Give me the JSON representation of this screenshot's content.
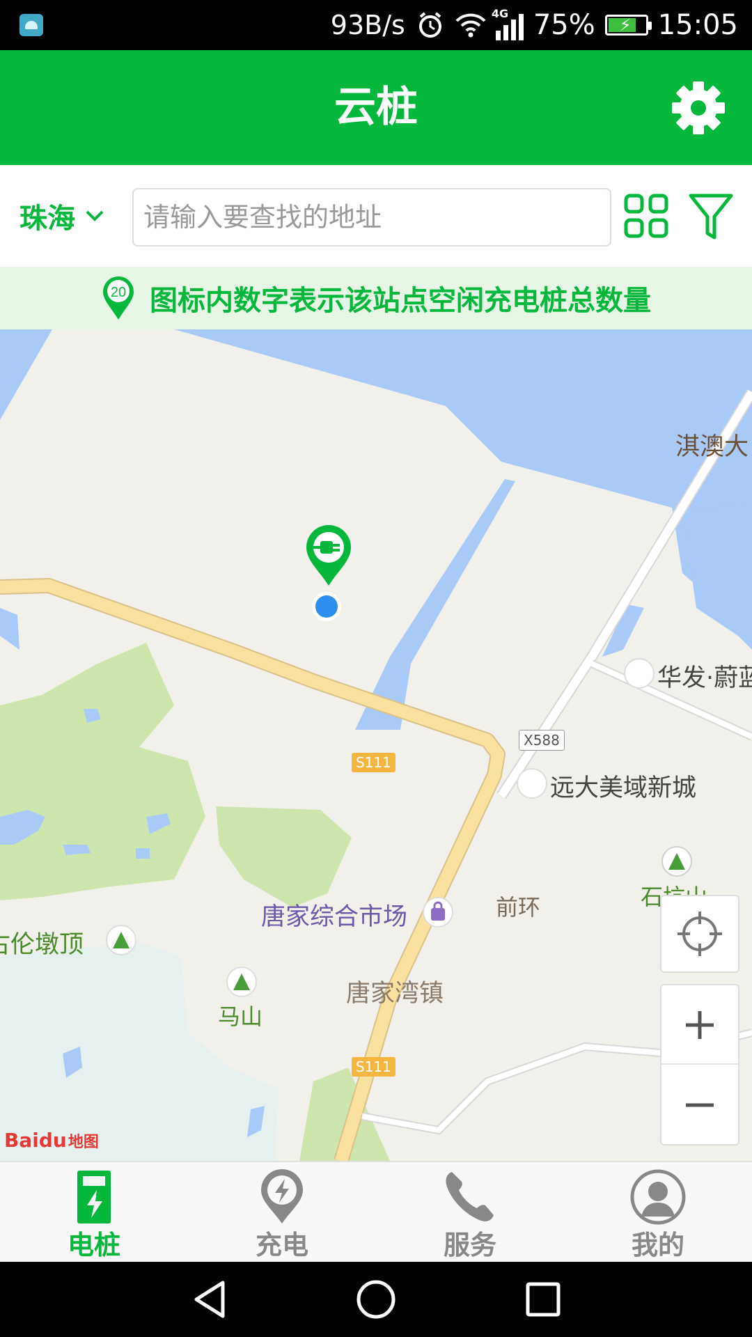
{
  "status_bar": {
    "net_speed": "93B/s",
    "network_type": "4G",
    "battery_percent": "75%",
    "battery_level": 0.75,
    "time": "15:05",
    "icons": [
      "android-debug-icon",
      "alarm-icon",
      "wifi-icon",
      "signal-icon",
      "battery-charging-icon"
    ]
  },
  "header": {
    "title": "云桩",
    "settings_icon": "gear-icon"
  },
  "search": {
    "city": "珠海",
    "city_icon": "chevron-down-icon",
    "placeholder": "请输入要查找的地址",
    "grid_icon": "grid-icon",
    "filter_icon": "filter-icon"
  },
  "info": {
    "badge_number": "20",
    "text": "图标内数字表示该站点空闲充电桩总数量"
  },
  "map": {
    "labels": {
      "qiao_bridge": "淇澳大",
      "huafa": "华发·蔚蓝",
      "yuanda": "远大美域新城",
      "shikeng": "石坑山",
      "market": "唐家综合市场",
      "qianhuan": "前环",
      "gulun": "金鼎古伦墩顶",
      "mashan": "马山",
      "tangjiawan": "唐家湾镇"
    },
    "road_tags": {
      "x588": "X588",
      "s111_a": "S111",
      "s111_b": "S111"
    },
    "baidu_logo": "Baidu",
    "baidu_logo_cn": "地图",
    "controls": {
      "locate_icon": "crosshair-icon",
      "zoom_in_icon": "plus-icon",
      "zoom_out_icon": "minus-icon"
    },
    "colors": {
      "water": "#a9c9f7",
      "land": "#f1f0eb",
      "green": "#cfe5ae",
      "road": "#f9e1a0",
      "pale_water": "#e6f0ee"
    }
  },
  "bottom_nav": {
    "items": [
      {
        "label": "电桩",
        "icon": "charging-pile-icon",
        "active": true
      },
      {
        "label": "充电",
        "icon": "charge-location-icon",
        "active": false
      },
      {
        "label": "服务",
        "icon": "phone-icon",
        "active": false
      },
      {
        "label": "我的",
        "icon": "user-icon",
        "active": false
      }
    ],
    "active_color": "#05b73a",
    "inactive_color": "#888888"
  },
  "system_nav": {
    "icons": [
      "back-icon",
      "home-icon",
      "recents-icon"
    ]
  }
}
